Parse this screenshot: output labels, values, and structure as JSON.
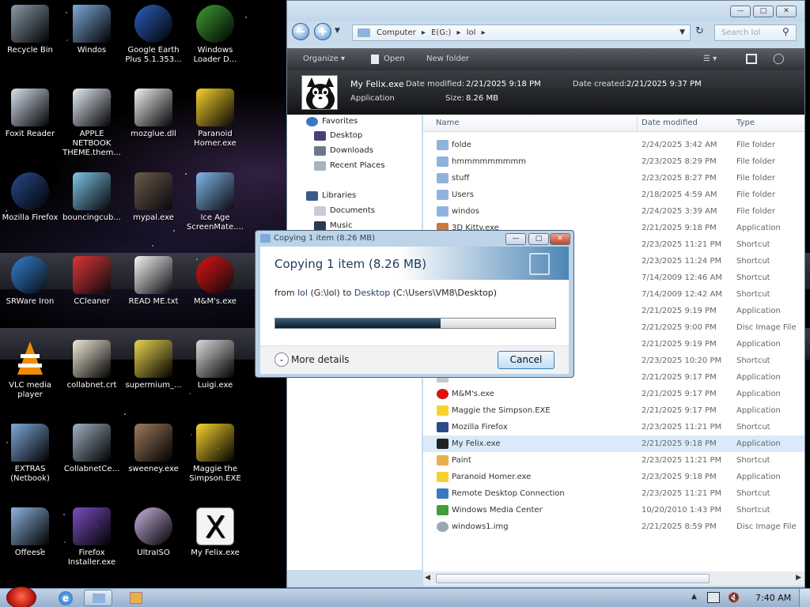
{
  "desktop": {
    "icons": [
      {
        "label": "Recycle Bin",
        "icon": "recycle-bin-icon",
        "color": "#8a9aa8"
      },
      {
        "label": "Windos",
        "icon": "folder-files-icon",
        "color": "#7fa9d9"
      },
      {
        "label": "Google Earth Plus 5.1.353...",
        "icon": "google-earth-icon",
        "color": "#2d5fbf"
      },
      {
        "label": "Windows Loader D...",
        "icon": "windows-orb-icon",
        "color": "#3f9e35"
      },
      {
        "label": "Foxit Reader",
        "icon": "foxit-reader-icon",
        "color": "#d8e2f0"
      },
      {
        "label": "APPLE NETBOOK THEME.them...",
        "icon": "theme-file-icon",
        "color": "#e6eef7"
      },
      {
        "label": "mozglue.dll",
        "icon": "dll-file-icon",
        "color": "#f2f2f2"
      },
      {
        "label": "Paranoid Homer.exe",
        "icon": "homer-icon",
        "color": "#f7d22e"
      },
      {
        "label": "Mozilla Firefox",
        "icon": "firefox-icon",
        "color": "#2a4a8c"
      },
      {
        "label": "bouncingcub...",
        "icon": "minecraft-cube-icon",
        "color": "#7ec6e6"
      },
      {
        "label": "mypal.exe",
        "icon": "raccoon-icon",
        "color": "#6b5b4a"
      },
      {
        "label": "Ice Age ScreenMate....",
        "icon": "ice-age-icon",
        "color": "#7fb8e8"
      },
      {
        "label": "SRWare Iron",
        "icon": "srware-iron-icon",
        "color": "#2f7fd0"
      },
      {
        "label": "CCleaner",
        "icon": "ccleaner-icon",
        "color": "#d33"
      },
      {
        "label": "READ ME.txt",
        "icon": "text-file-icon",
        "color": "#f4f4f4"
      },
      {
        "label": "M&M's.exe",
        "icon": "mms-icon",
        "color": "#d11"
      },
      {
        "label": "VLC media player",
        "icon": "vlc-cone-icon",
        "color": "#f08a00"
      },
      {
        "label": "collabnet.crt",
        "icon": "certificate-icon",
        "color": "#efe8d6"
      },
      {
        "label": "supermium_...",
        "icon": "installer-icon",
        "color": "#e8d24a"
      },
      {
        "label": "Luigi.exe",
        "icon": "luigi-monitor-icon",
        "color": "#d9d9d9"
      },
      {
        "label": "EXTRAS (Netbook)",
        "icon": "folder-icon",
        "color": "#7fa9d9"
      },
      {
        "label": "CollabnetCe...",
        "icon": "collabnet-icon",
        "color": "#9fb0c0"
      },
      {
        "label": "sweeney.exe",
        "icon": "sweeney-photo-icon",
        "color": "#9b7a5c"
      },
      {
        "label": "Maggie the Simpson.EXE",
        "icon": "maggie-icon",
        "color": "#f7d22e"
      },
      {
        "label": "Offeese",
        "icon": "folder-files-icon",
        "color": "#8fb3dd"
      },
      {
        "label": "Firefox Installer.exe",
        "icon": "firefox-installer-icon",
        "color": "#7a4ec0"
      },
      {
        "label": "UltraISO",
        "icon": "disc-icon",
        "color": "#c9b3e0"
      },
      {
        "label": "My Felix.exe",
        "icon": "x-window-icon",
        "color": "#f4f4f4"
      }
    ]
  },
  "explorer": {
    "breadcrumb": [
      "Computer",
      "E(G:)",
      "lol"
    ],
    "search_placeholder": "Search lol",
    "toolbar": {
      "organize": "Organize",
      "open": "Open",
      "new_folder": "New folder"
    },
    "details": {
      "name": "My Felix.exe",
      "kind": "Application",
      "modified_label": "Date modified:",
      "modified": "2/21/2025 9:18 PM",
      "created_label": "Date created:",
      "created": "2/21/2025 9:37 PM",
      "size_label": "Size:",
      "size": "8.26 MB"
    },
    "nav": {
      "favorites": "Favorites",
      "desktop": "Desktop",
      "downloads": "Downloads",
      "recent": "Recent Places",
      "libraries": "Libraries",
      "documents": "Documents",
      "music": "Music"
    },
    "columns": {
      "name": "Name",
      "date": "Date modified",
      "type": "Type"
    },
    "files": [
      {
        "name": "folde",
        "date": "2/24/2025 3:42 AM",
        "type": "File folder",
        "icon": "folder-icon",
        "color": "#8fb3dd"
      },
      {
        "name": "hmmmmmmmmm",
        "date": "2/23/2025 8:29 PM",
        "type": "File folder",
        "icon": "folder-icon",
        "color": "#8fb3dd"
      },
      {
        "name": "stuff",
        "date": "2/23/2025 8:27 PM",
        "type": "File folder",
        "icon": "folder-icon",
        "color": "#8fb3dd"
      },
      {
        "name": "Users",
        "date": "2/18/2025 4:59 AM",
        "type": "File folder",
        "icon": "folder-icon",
        "color": "#8fb3dd"
      },
      {
        "name": "windos",
        "date": "2/24/2025 3:39 AM",
        "type": "File folder",
        "icon": "folder-icon",
        "color": "#8fb3dd"
      },
      {
        "name": "3D Kitty.exe",
        "date": "2/21/2025 9:18 PM",
        "type": "Application",
        "icon": "kitty-icon",
        "color": "#c97a3a"
      },
      {
        "name": "",
        "date": "2/23/2025 11:21 PM",
        "type": "Shortcut",
        "icon": "shortcut-icon",
        "color": "#b8c6d6"
      },
      {
        "name": "",
        "date": "2/23/2025 11:24 PM",
        "type": "Shortcut",
        "icon": "shortcut-icon",
        "color": "#b8c6d6"
      },
      {
        "name": "",
        "date": "7/14/2009 12:46 AM",
        "type": "Shortcut",
        "icon": "shortcut-icon",
        "color": "#b8c6d6"
      },
      {
        "name": "",
        "date": "7/14/2009 12:42 AM",
        "type": "Shortcut",
        "icon": "shortcut-icon",
        "color": "#b8c6d6"
      },
      {
        "name": "",
        "date": "2/21/2025 9:19 PM",
        "type": "Application",
        "icon": "app-icon",
        "color": "#c0c8d0"
      },
      {
        "name": "",
        "date": "2/21/2025 9:00 PM",
        "type": "Disc Image File",
        "icon": "disc-image-icon",
        "color": "#c0c8d0"
      },
      {
        "name": "",
        "date": "2/21/2025 9:19 PM",
        "type": "Application",
        "icon": "app-icon",
        "color": "#c0c8d0"
      },
      {
        "name": "",
        "date": "2/23/2025 10:20 PM",
        "type": "Shortcut",
        "icon": "shortcut-icon",
        "color": "#b8c6d6"
      },
      {
        "name": "",
        "date": "2/21/2025 9:17 PM",
        "type": "Application",
        "icon": "app-icon",
        "color": "#c0c8d0"
      },
      {
        "name": "M&M's.exe",
        "date": "2/21/2025 9:17 PM",
        "type": "Application",
        "icon": "mms-icon",
        "color": "#d11"
      },
      {
        "name": "Maggie the Simpson.EXE",
        "date": "2/21/2025 9:17 PM",
        "type": "Application",
        "icon": "maggie-icon",
        "color": "#f7d22e"
      },
      {
        "name": "Mozilla Firefox",
        "date": "2/23/2025 11:21 PM",
        "type": "Shortcut",
        "icon": "firefox-icon",
        "color": "#2a4a8c"
      },
      {
        "name": "My Felix.exe",
        "date": "2/21/2025 9:18 PM",
        "type": "Application",
        "icon": "felix-icon",
        "color": "#222",
        "selected": true
      },
      {
        "name": "Paint",
        "date": "2/23/2025 11:21 PM",
        "type": "Shortcut",
        "icon": "paint-icon",
        "color": "#e8b04a"
      },
      {
        "name": "Paranoid Homer.exe",
        "date": "2/23/2025 9:18 PM",
        "type": "Application",
        "icon": "homer-icon",
        "color": "#f7d22e"
      },
      {
        "name": "Remote Desktop Connection",
        "date": "2/23/2025 11:21 PM",
        "type": "Shortcut",
        "icon": "remote-desktop-icon",
        "color": "#3a78c2"
      },
      {
        "name": "Windows Media Center",
        "date": "10/20/2010 1:43 PM",
        "type": "Shortcut",
        "icon": "media-center-icon",
        "color": "#3f9e35"
      },
      {
        "name": "windows1.img",
        "date": "2/21/2025 8:59 PM",
        "type": "Disc Image File",
        "icon": "disc-image-icon",
        "color": "#9aa7b4"
      }
    ]
  },
  "copy_dialog": {
    "title": "Copying 1 item (8.26 MB)",
    "heading": "Copying 1 item (8.26 MB)",
    "from_word": "from",
    "src": "lol",
    "src_path": "(G:\\lol)",
    "to_word": "to",
    "dst": "Desktop",
    "dst_path": "(C:\\Users\\VM8\\Desktop)",
    "progress": 0.59,
    "more_details": "More details",
    "cancel": "Cancel"
  },
  "taskbar": {
    "clock": "7:40 AM"
  }
}
